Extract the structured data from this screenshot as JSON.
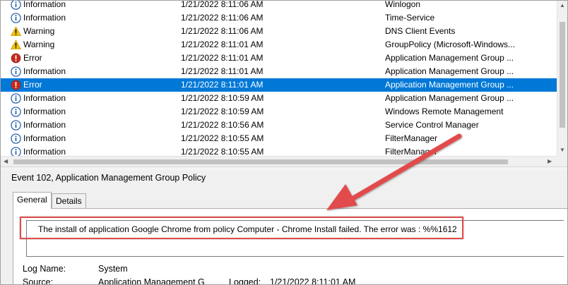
{
  "events": [
    {
      "level": "Information",
      "date": "1/21/2022 8:11:06 AM",
      "source": "Winlogon",
      "icon": "info-icon",
      "selected": false
    },
    {
      "level": "Information",
      "date": "1/21/2022 8:11:06 AM",
      "source": "Time-Service",
      "icon": "info-icon",
      "selected": false
    },
    {
      "level": "Warning",
      "date": "1/21/2022 8:11:06 AM",
      "source": "DNS Client Events",
      "icon": "warning-icon",
      "selected": false
    },
    {
      "level": "Warning",
      "date": "1/21/2022 8:11:01 AM",
      "source": "GroupPolicy (Microsoft-Windows...",
      "icon": "warning-icon",
      "selected": false
    },
    {
      "level": "Error",
      "date": "1/21/2022 8:11:01 AM",
      "source": "Application Management Group ...",
      "icon": "error-icon",
      "selected": false
    },
    {
      "level": "Information",
      "date": "1/21/2022 8:11:01 AM",
      "source": "Application Management Group ...",
      "icon": "info-icon",
      "selected": false
    },
    {
      "level": "Error",
      "date": "1/21/2022 8:11:01 AM",
      "source": "Application Management Group ...",
      "icon": "error-icon",
      "selected": true
    },
    {
      "level": "Information",
      "date": "1/21/2022 8:10:59 AM",
      "source": "Application Management Group ...",
      "icon": "info-icon",
      "selected": false
    },
    {
      "level": "Information",
      "date": "1/21/2022 8:10:59 AM",
      "source": "Windows Remote Management",
      "icon": "info-icon",
      "selected": false
    },
    {
      "level": "Information",
      "date": "1/21/2022 8:10:56 AM",
      "source": "Service Control Manager",
      "icon": "info-icon",
      "selected": false
    },
    {
      "level": "Information",
      "date": "1/21/2022 8:10:55 AM",
      "source": "FilterManager",
      "icon": "info-icon",
      "selected": false
    },
    {
      "level": "Information",
      "date": "1/21/2022 8:10:55 AM",
      "source": "FilterManager",
      "icon": "info-icon",
      "selected": false
    }
  ],
  "details": {
    "title": "Event 102, Application Management Group Policy",
    "tabs": {
      "general": "General",
      "details": "Details"
    },
    "message": "The install of application Google Chrome from policy Computer - Chrome Install failed.  The error was : %%1612",
    "props": {
      "log_name_label": "Log Name:",
      "log_name_value": "System",
      "source_label": "Source:",
      "source_value": "Application Management Gr",
      "logged_label": "Logged:",
      "logged_value": "1/21/2022 8:11:01 AM"
    }
  },
  "colors": {
    "selection": "#0078d7",
    "annotation": "#e24b4b",
    "info_icon": "#1e5aa8",
    "warning_icon": "#f2c200",
    "error_icon": "#c42b1c"
  }
}
